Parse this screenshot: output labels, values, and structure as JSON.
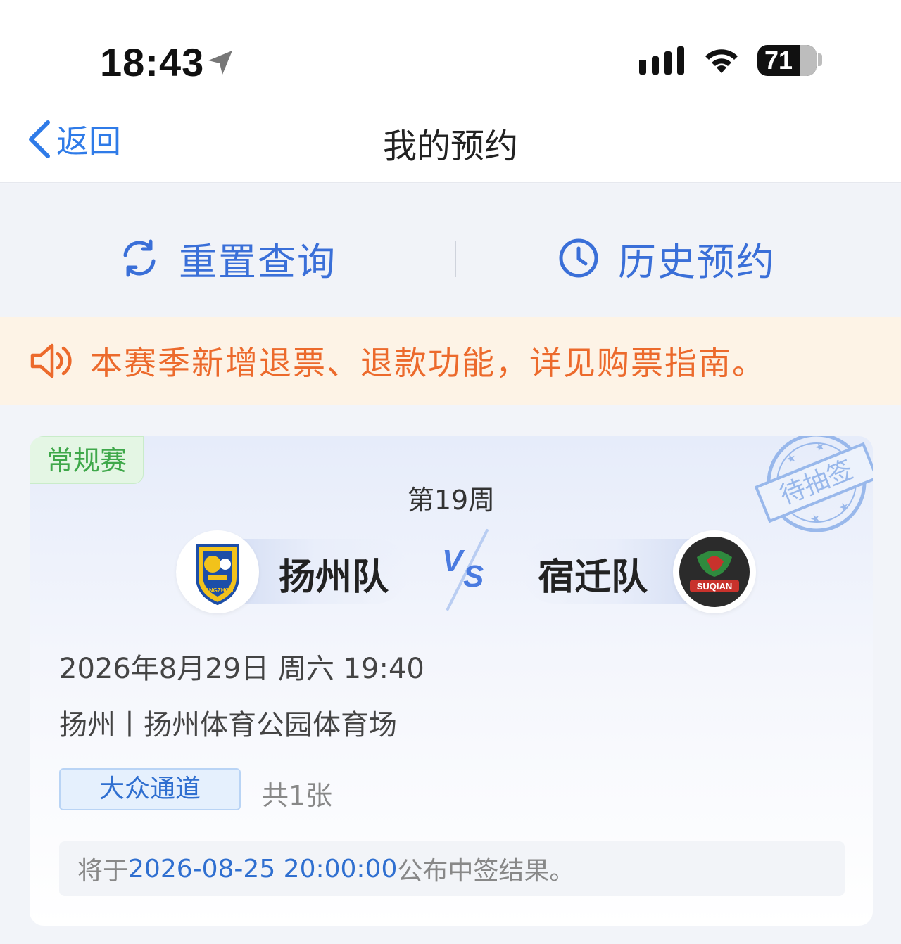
{
  "status_bar": {
    "time": "18:43",
    "battery_level": "71"
  },
  "nav": {
    "back_label": "返回",
    "title": "我的预约"
  },
  "actions": {
    "reset_label": "重置查询",
    "history_label": "历史预约"
  },
  "notice": {
    "text": "本赛季新增退票、退款功能，详见购票指南。"
  },
  "booking": {
    "type_tag": "常规赛",
    "stamp_text": "待抽签",
    "round": "第19周",
    "home_team": "扬州队",
    "away_team": "宿迁队",
    "home_logo_text": "YANGZHOU",
    "away_logo_text": "SUQIAN",
    "datetime": "2026年8月29日 周六 19:40",
    "venue": "扬州丨扬州体育公园体育场",
    "channel": "大众通道",
    "ticket_count": "共1张",
    "result_prefix": "将于",
    "result_date": "2026-08-25 20:00:00",
    "result_suffix": "公布中签结果。"
  },
  "colors": {
    "accent_blue": "#2f7be8",
    "notice_orange": "#ec6a2c",
    "notice_bg": "#fdf3e6",
    "tag_green": "#3fa84a"
  }
}
